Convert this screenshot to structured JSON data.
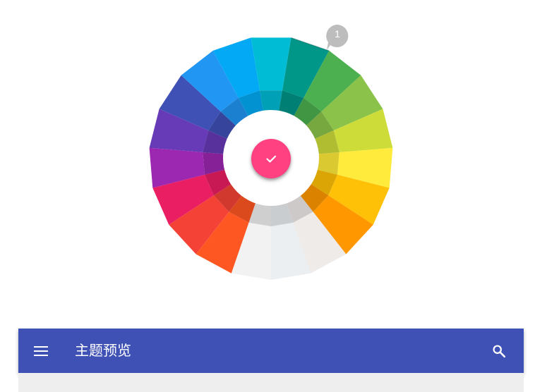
{
  "wheel": {
    "colors": [
      {
        "name": "cyan",
        "hex": "#00BCD4"
      },
      {
        "name": "teal",
        "hex": "#009688"
      },
      {
        "name": "green",
        "hex": "#4CAF50"
      },
      {
        "name": "light-green",
        "hex": "#8BC34A"
      },
      {
        "name": "lime",
        "hex": "#CDDC39"
      },
      {
        "name": "yellow",
        "hex": "#FFEB3B"
      },
      {
        "name": "amber",
        "hex": "#FFC107"
      },
      {
        "name": "orange",
        "hex": "#FF9800"
      },
      {
        "name": "brown",
        "hex": "#EFEBE9"
      },
      {
        "name": "blue-grey",
        "hex": "#ECEFF1"
      },
      {
        "name": "grey",
        "hex": "#F2F2F2"
      },
      {
        "name": "deep-orange",
        "hex": "#FF5722"
      },
      {
        "name": "red",
        "hex": "#F44336"
      },
      {
        "name": "pink",
        "hex": "#E91E63"
      },
      {
        "name": "purple",
        "hex": "#9C27B0"
      },
      {
        "name": "deep-purple",
        "hex": "#673AB7"
      },
      {
        "name": "indigo",
        "hex": "#3F51B5"
      },
      {
        "name": "blue",
        "hex": "#2196F3"
      },
      {
        "name": "light-blue",
        "hex": "#03A9F4"
      }
    ],
    "selected_index": 1,
    "marker_label": "1"
  },
  "confirm": {
    "color": "#FF4081",
    "icon": "check-icon"
  },
  "preview": {
    "toolbar_color": "#3F51B5",
    "title": "主题预览",
    "menu_icon": "menu-icon",
    "search_icon": "search-icon"
  }
}
